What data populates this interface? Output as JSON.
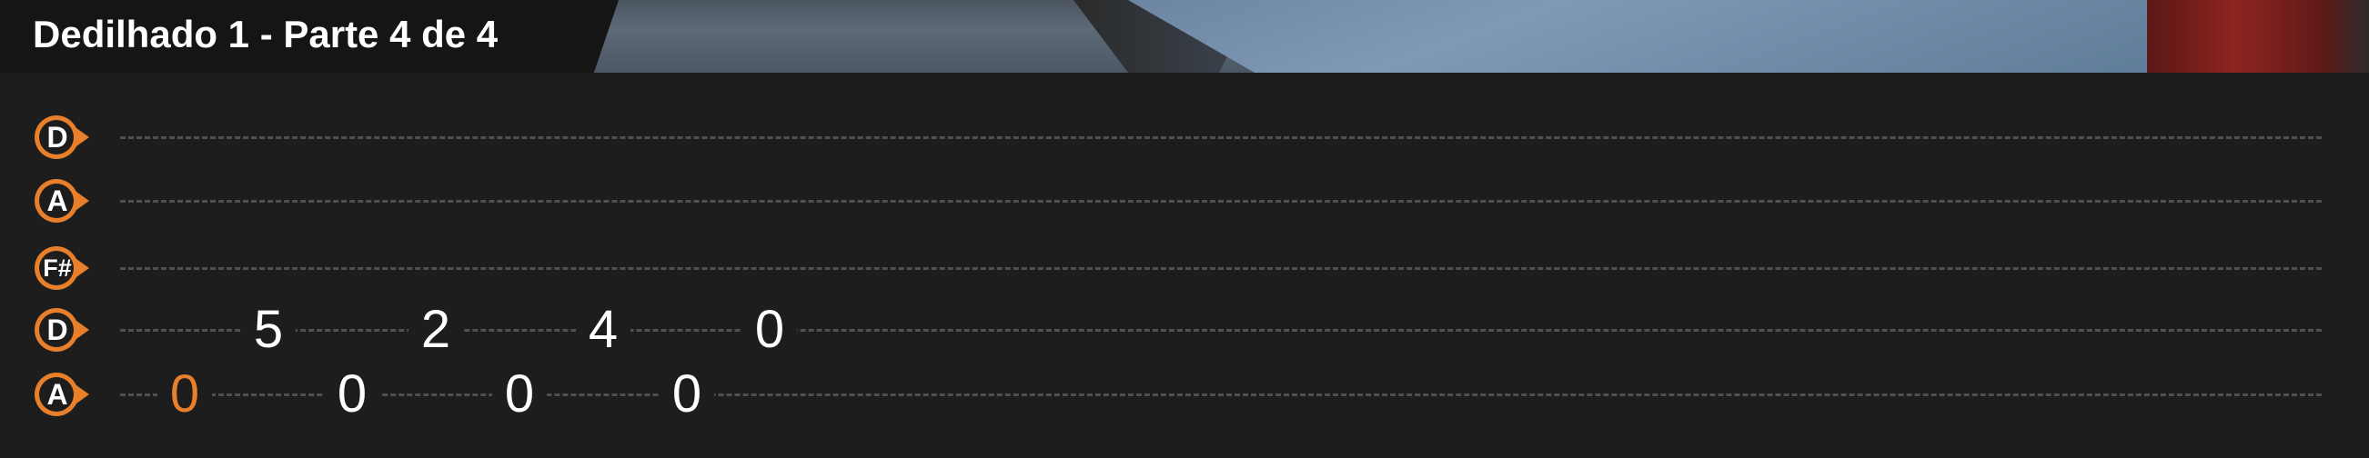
{
  "header": {
    "title": "Dedilhado 1 - Parte 4 de 4"
  },
  "colors": {
    "accent": "#e87f2a",
    "background": "#1d1d1d",
    "line": "#505050",
    "note": "#ffffff"
  },
  "strings": [
    {
      "label": "D",
      "notes": []
    },
    {
      "label": "A",
      "notes": []
    },
    {
      "label": "F#",
      "notes": []
    },
    {
      "label": "D",
      "notes": [
        {
          "fret": "5",
          "active": false
        },
        {
          "fret": "2",
          "active": false
        },
        {
          "fret": "4",
          "active": false
        },
        {
          "fret": "0",
          "active": false
        }
      ]
    },
    {
      "label": "A",
      "notes": [
        {
          "fret": "0",
          "active": true
        },
        {
          "fret": "0",
          "active": false
        },
        {
          "fret": "0",
          "active": false
        },
        {
          "fret": "0",
          "active": false
        }
      ]
    }
  ]
}
